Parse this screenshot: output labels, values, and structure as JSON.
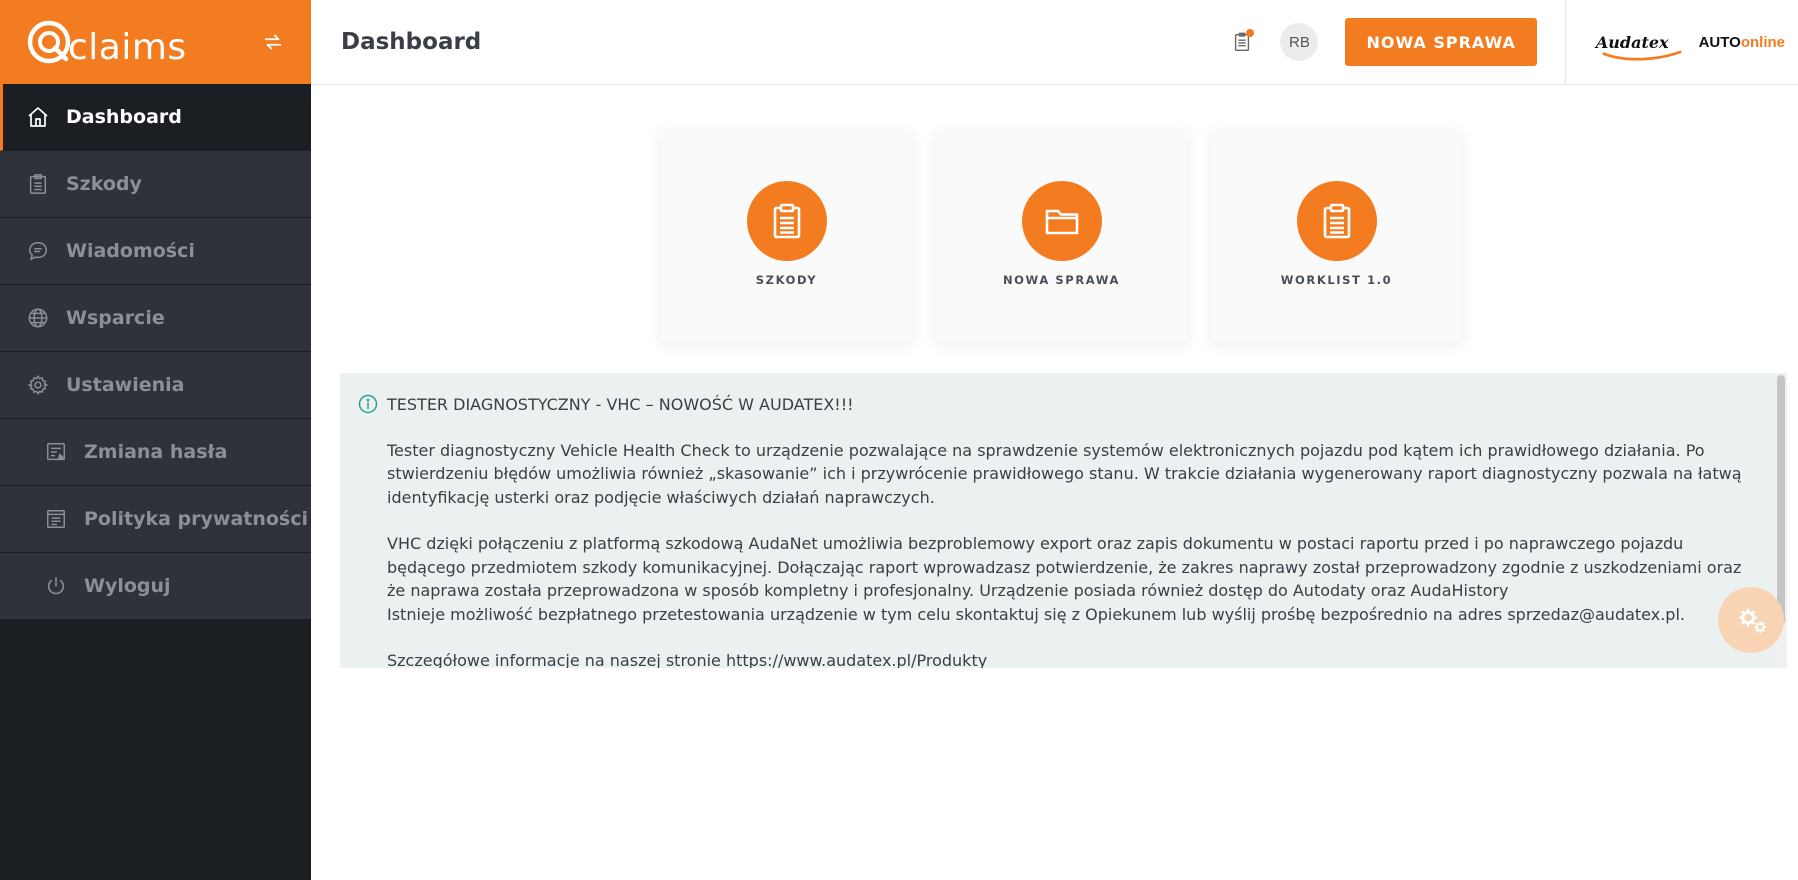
{
  "brand": {
    "logo_text": "claims"
  },
  "sidebar": {
    "items": [
      {
        "label": "Dashboard",
        "icon": "home-icon"
      },
      {
        "label": "Szkody",
        "icon": "clipboard-icon"
      },
      {
        "label": "Wiadomości",
        "icon": "chat-icon"
      },
      {
        "label": "Wsparcie",
        "icon": "globe-icon"
      },
      {
        "label": "Ustawienia",
        "icon": "gear-icon"
      },
      {
        "label": "Zmiana hasła",
        "icon": "password-form-icon"
      },
      {
        "label": "Polityka prywatności",
        "icon": "document-icon"
      },
      {
        "label": "Wyloguj",
        "icon": "power-icon"
      }
    ]
  },
  "header": {
    "title": "Dashboard",
    "avatar_initials": "RB",
    "new_case_label": "NOWA SPRAWA",
    "brand_audatex": "Audatex",
    "brand_auto": "AUTO",
    "brand_online": "online"
  },
  "tiles": [
    {
      "label": "SZKODY",
      "icon": "clipboard-icon"
    },
    {
      "label": "NOWA SPRAWA",
      "icon": "folder-icon"
    },
    {
      "label": "WORKLIST 1.0",
      "icon": "clipboard-icon"
    }
  ],
  "info": {
    "title": "TESTER DIAGNOSTYCZNY - VHC – NOWOŚĆ W AUDATEX!!!",
    "p1": "Tester diagnostyczny Vehicle Health Check to urządzenie pozwalające na sprawdzenie systemów elektronicznych pojazdu pod kątem ich prawidłowego działania. Po stwierdzeniu błędów umożliwia również „skasowanie” ich i przywrócenie prawidłowego stanu. W trakcie działania wygenerowany raport diagnostyczny pozwala na łatwą identyfikację usterki oraz podjęcie właściwych działań naprawczych.",
    "p2": "VHC dzięki połączeniu z platformą szkodową AudaNet umożliwia bezproblemowy export oraz zapis dokumentu w postaci raportu przed i po naprawczego pojazdu będącego przedmiotem szkody komunikacyjnej. Dołączając raport wprowadzasz potwierdzenie, że zakres naprawy został przeprowadzony zgodnie z uszkodzeniami oraz że naprawa została przeprowadzona w sposób kompletny i profesjonalny. Urządzenie posiada również dostęp do Autodaty oraz AudaHistory",
    "p3": "Istnieje możliwość bezpłatnego przetestowania urządzenie w tym celu skontaktuj się z Opiekunem lub wyślij prośbę bezpośrednio na adres sprzedaz@audatex.pl.",
    "p4": "Szczegółowe informacje na naszej stronie https://www.audatex.pl/Produkty"
  },
  "colors": {
    "accent": "#f47c20",
    "sidebar_bg": "#1b1e23",
    "sidebar_item_bg": "#2f3238",
    "info_bg": "#ebf1f0"
  }
}
